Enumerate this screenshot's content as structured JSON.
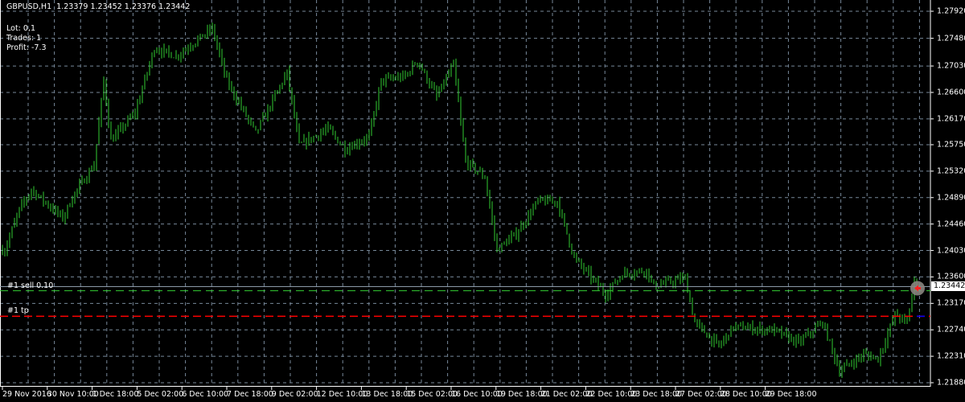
{
  "header": {
    "symbol": "GBPUSD,H1",
    "ohlc": "1.23379 1.23452 1.23376 1.23442"
  },
  "info": {
    "lot": "Lot: 0,1",
    "trades": "Trades: 1",
    "profit": "Profit: -7.3"
  },
  "orders": {
    "sell_label": "#1 sell 0.10",
    "tp_label": "#1 tp"
  },
  "current_price": "1.23442",
  "colors": {
    "bars": "#32cd32",
    "grid": "#778899",
    "tp": "#ff0000",
    "sell": "#32cd32",
    "bid": "#8c9aa8"
  },
  "chart_data": {
    "type": "bar",
    "title": "GBPUSD,H1",
    "ylim": [
      1.2188,
      1.2792
    ],
    "price_ticks": [
      "1.27920",
      "1.27480",
      "1.27030",
      "1.26600",
      "1.26170",
      "1.25750",
      "1.25320",
      "1.24890",
      "1.24460",
      "1.24030",
      "1.23600",
      "1.23170",
      "1.22740",
      "1.22310",
      "1.21880"
    ],
    "time_ticks": [
      "29 Nov 2016",
      "30 Nov 10:00",
      "1 Dec 18:00",
      "5 Dec 02:00",
      "6 Dec 10:00",
      "7 Dec 18:00",
      "9 Dec 02:00",
      "12 Dec 10:00",
      "13 Dec 18:00",
      "15 Dec 02:00",
      "16 Dec 10:00",
      "19 Dec 18:00",
      "21 Dec 02:00",
      "22 Dec 10:00",
      "23 Dec 18:00",
      "27 Dec 02:00",
      "28 Dec 10:00",
      "29 Dec 18:00"
    ],
    "bar_count": 381,
    "close_keypoints": [
      [
        1,
        1.2404
      ],
      [
        7,
        1.2469
      ],
      [
        12,
        1.2502
      ],
      [
        25,
        1.2456
      ],
      [
        30,
        1.2496
      ],
      [
        38,
        1.2542
      ],
      [
        42,
        1.2679
      ],
      [
        45,
        1.2581
      ],
      [
        55,
        1.2627
      ],
      [
        63,
        1.2732
      ],
      [
        72,
        1.2719
      ],
      [
        87,
        1.2764
      ],
      [
        93,
        1.2679
      ],
      [
        105,
        1.2594
      ],
      [
        118,
        1.2692
      ],
      [
        123,
        1.2574
      ],
      [
        135,
        1.2601
      ],
      [
        142,
        1.2568
      ],
      [
        152,
        1.2588
      ],
      [
        157,
        1.2679
      ],
      [
        167,
        1.2686
      ],
      [
        172,
        1.2712
      ],
      [
        180,
        1.2653
      ],
      [
        187,
        1.2705
      ],
      [
        192,
        1.2548
      ],
      [
        200,
        1.2522
      ],
      [
        205,
        1.2404
      ],
      [
        213,
        1.243
      ],
      [
        222,
        1.2483
      ],
      [
        230,
        1.2483
      ],
      [
        237,
        1.2391
      ],
      [
        250,
        1.2332
      ],
      [
        257,
        1.2365
      ],
      [
        267,
        1.2371
      ],
      [
        270,
        1.2345
      ],
      [
        283,
        1.2358
      ],
      [
        287,
        1.2286
      ],
      [
        297,
        1.2247
      ],
      [
        303,
        1.2279
      ],
      [
        320,
        1.2273
      ],
      [
        330,
        1.2253
      ],
      [
        340,
        1.2286
      ],
      [
        347,
        1.2207
      ],
      [
        357,
        1.2234
      ],
      [
        363,
        1.2227
      ],
      [
        370,
        1.2299
      ],
      [
        375,
        1.2286
      ],
      [
        378,
        1.2352
      ],
      [
        380,
        1.23442
      ]
    ],
    "bid": 1.23442,
    "sell_price": 1.23375,
    "tp_price": 1.2296
  }
}
